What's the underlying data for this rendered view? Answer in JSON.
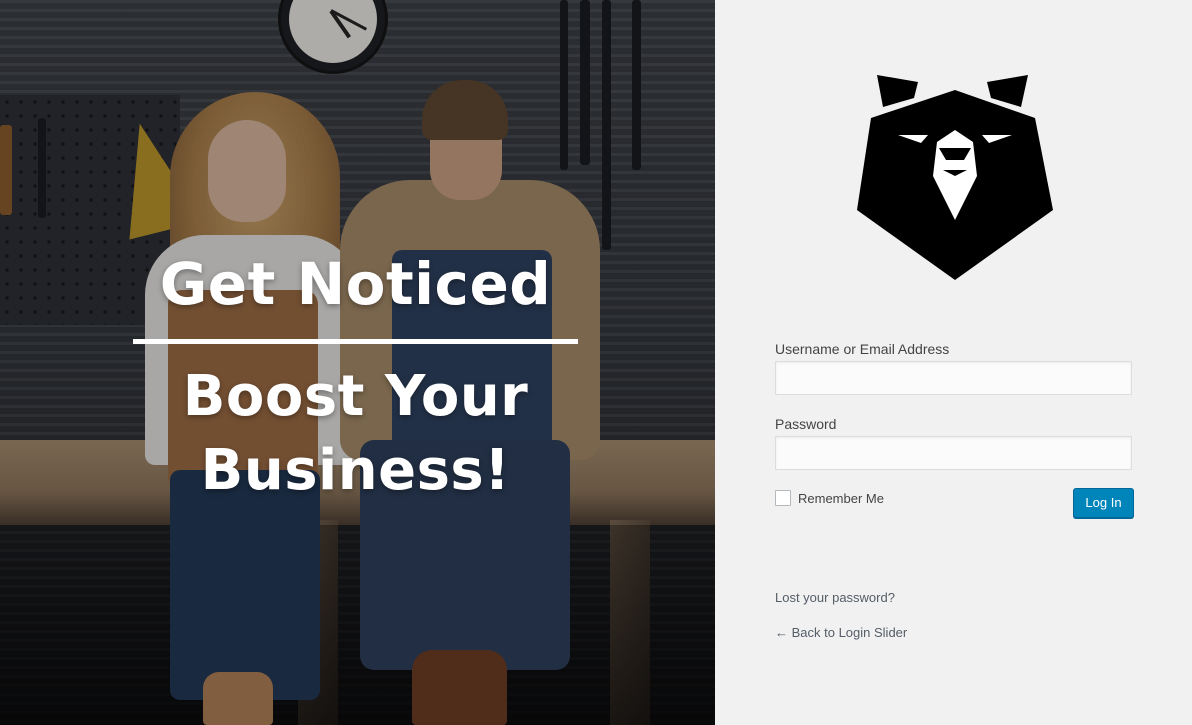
{
  "hero": {
    "headline_line1": "Get Noticed",
    "headline_line2": "Boost Your",
    "headline_line3": "Business!"
  },
  "logo": {
    "icon": "bear-head-icon"
  },
  "form": {
    "username_label": "Username or Email Address",
    "username_value": "",
    "password_label": "Password",
    "password_value": "",
    "remember_label": "Remember Me",
    "remember_checked": false,
    "login_button": "Log In"
  },
  "links": {
    "lost_password": "Lost your password?",
    "back_link": "← Back to Login Slider"
  },
  "colors": {
    "accent": "#0085ba",
    "panel_background": "#f1f1f1",
    "logo": "#000000"
  }
}
